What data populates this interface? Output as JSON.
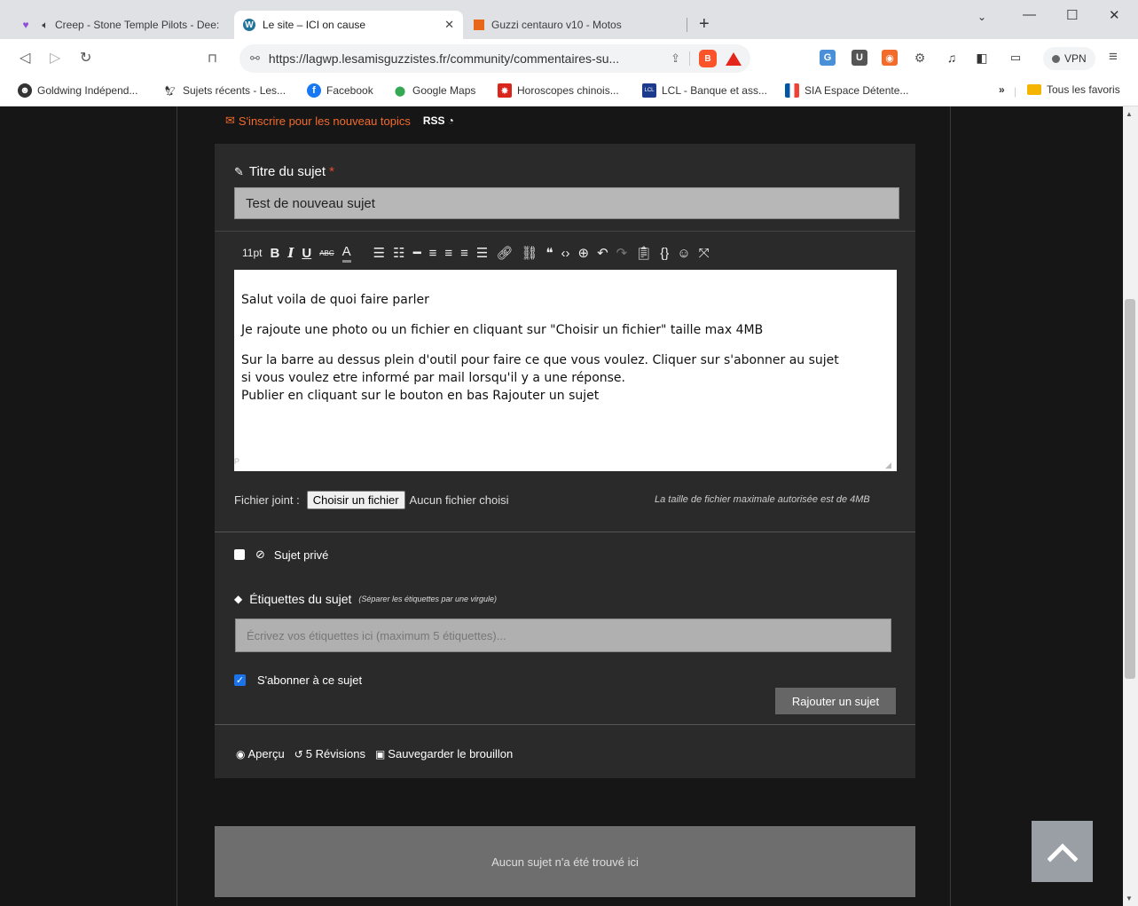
{
  "browser": {
    "tabs": [
      {
        "label": "Creep - Stone Temple Pilots - Dee:",
        "active": false
      },
      {
        "label": "Le site – ICI on cause",
        "active": true
      },
      {
        "label": "Guzzi centauro v10 - Motos",
        "active": false
      }
    ],
    "url": "https://lagwp.lesamisguzzistes.fr/community/commentaires-su...",
    "vpn_label": "VPN",
    "bookmarks": [
      "Goldwing Indépend...",
      "Sujets récents - Les...",
      "Facebook",
      "Google Maps",
      "Horoscopes chinois...",
      "LCL - Banque et ass...",
      "SIA Espace Détente..."
    ],
    "bookmarks_overflow": "»",
    "all_bookmarks": "Tous les favoris"
  },
  "page": {
    "subscribe_link": "S'inscrire pour les nouveau topics",
    "rss": "RSS",
    "topic_title_label": "Titre du sujet",
    "required_mark": "*",
    "topic_title_value": "Test de nouveau sujet",
    "editor": {
      "font_size": "11pt",
      "paragraphs": [
        "Salut voila de quoi faire parler",
        "Je rajoute une photo ou un fichier en cliquant sur \"Choisir un fichier\" taille max 4MB",
        "Sur la barre au dessus plein d'outil pour faire ce que vous voulez. Cliquer sur s'abonner au sujet\nsi vous voulez etre informé par mail lorsqu'il y a une réponse.\nPublier en cliquant sur le bouton en bas Rajouter un sujet"
      ],
      "path": "P"
    },
    "attachment_label": "Fichier joint :",
    "choose_file": "Choisir un fichier",
    "no_file": "Aucun fichier choisi",
    "max_size_hint": "La taille de fichier maximale autorisée est de 4MB",
    "private_label": "Sujet privé",
    "tags_label": "Étiquettes du sujet",
    "tags_note": "(Séparer les étiquettes par une virgule)",
    "tags_placeholder": "Écrivez vos étiquettes ici (maximum 5 étiquettes)...",
    "subscribe_topic_label": "S'abonner à ce sujet",
    "subscribe_topic_checked": true,
    "add_topic_button": "Rajouter un sujet",
    "preview": "Aperçu",
    "revisions": "5 Révisions",
    "save_draft": "Sauvegarder le brouillon",
    "empty_message": "Aucun sujet n'a été trouvé ici"
  }
}
